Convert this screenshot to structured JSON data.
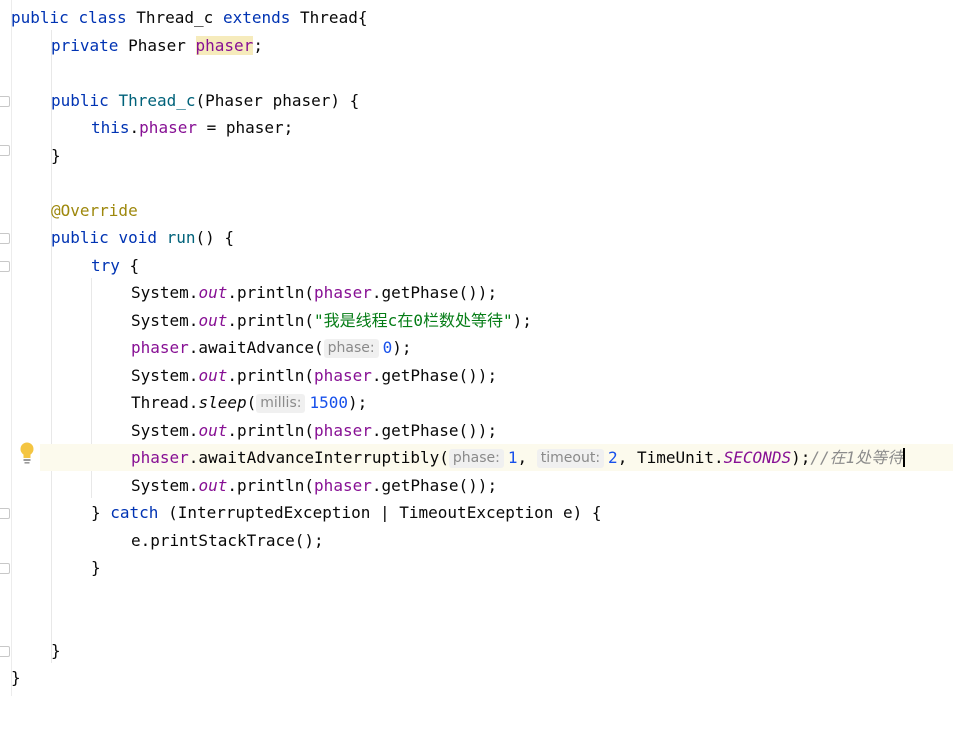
{
  "editor": {
    "lines": {
      "l1": {
        "kw_public": "public",
        "kw_class": "class",
        "name": "Thread_c",
        "kw_extends": "extends",
        "parent": "Thread{"
      },
      "l2": {
        "kw_private": "private",
        "type": "Phaser",
        "field": "phaser",
        "end": ";"
      },
      "l4": {
        "kw_public": "public",
        "method": "Thread_c",
        "params": "(Phaser phaser) {"
      },
      "l5": {
        "kw_this": "this",
        "dot": ".",
        "field": "phaser",
        "rest": " = phaser;"
      },
      "l6": {
        "text": "}"
      },
      "l8": {
        "annotation": "@Override"
      },
      "l9": {
        "kw_public": "public",
        "kw_void": "void",
        "method": "run",
        "rest": "() {"
      },
      "l10": {
        "kw_try": "try",
        "rest": " {"
      },
      "l11": {
        "cls": "System.",
        "out": "out",
        "println": ".println(",
        "field": "phaser",
        "rest": ".getPhase());"
      },
      "l12": {
        "cls": "System.",
        "out": "out",
        "println": ".println(",
        "string": "\"我是线程c在0栏数处等待\"",
        "rest": ");"
      },
      "l13": {
        "field": "phaser",
        "call": ".awaitAdvance(",
        "hint": "phase:",
        "num": "0",
        "rest": ");"
      },
      "l14": {
        "cls": "System.",
        "out": "out",
        "println": ".println(",
        "field": "phaser",
        "rest": ".getPhase());"
      },
      "l15": {
        "cls": "Thread.",
        "sleep": "sleep",
        "open": "(",
        "hint": "millis:",
        "num": "1500",
        "rest": ");"
      },
      "l16": {
        "cls": "System.",
        "out": "out",
        "println": ".println(",
        "field": "phaser",
        "rest": ".getPhase());"
      },
      "l17": {
        "field": "phaser",
        "call": ".awaitAdvanceInterruptibly(",
        "hint1": "phase:",
        "num1": "1",
        "sep1": ", ",
        "hint2": "timeout:",
        "num2": "2",
        "sep2": ", ",
        "unit": "TimeUnit.",
        "seconds": "SECONDS",
        "rest": ");",
        "comment": "//在1处等待"
      },
      "l18": {
        "cls": "System.",
        "out": "out",
        "println": ".println(",
        "field": "phaser",
        "rest": ".getPhase());"
      },
      "l19": {
        "brace": "} ",
        "kw_catch": "catch",
        "rest": " (InterruptedException | TimeoutException e) {"
      },
      "l20": {
        "text": "e.printStackTrace();"
      },
      "l21": {
        "text": "}"
      },
      "l24": {
        "text": "}"
      },
      "l25": {
        "text": "}"
      }
    }
  },
  "icons": {
    "intention": "lightbulb-icon",
    "fold": "fold-marker-icon"
  },
  "colors": {
    "keyword": "#0033b3",
    "field": "#871094",
    "method": "#00627a",
    "annotation": "#9e880d",
    "string": "#067d17",
    "number": "#1750eb",
    "comment": "#8c8c8c",
    "current_line": "#fcfaed",
    "bulb": "#f4c542"
  }
}
